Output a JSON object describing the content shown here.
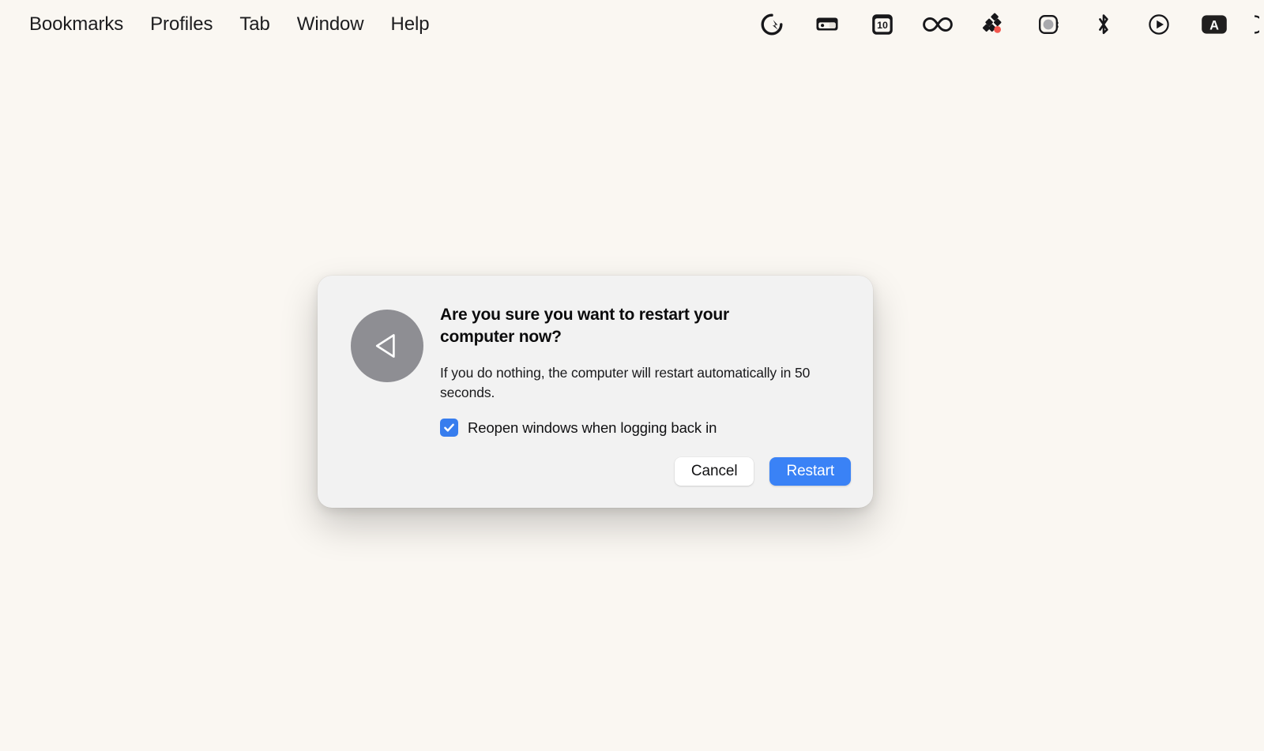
{
  "menubar": {
    "items": [
      {
        "label": "Bookmarks",
        "name": "menu-bookmarks"
      },
      {
        "label": "Profiles",
        "name": "menu-profiles"
      },
      {
        "label": "Tab",
        "name": "menu-tab"
      },
      {
        "label": "Window",
        "name": "menu-window"
      },
      {
        "label": "Help",
        "name": "menu-help"
      }
    ],
    "status_icons": [
      {
        "icon": "quicksilver-q-icon",
        "label": ""
      },
      {
        "icon": "wallet-card-icon",
        "label": ""
      },
      {
        "icon": "calendar-icon",
        "label": "10"
      },
      {
        "icon": "infinity-icon",
        "label": ""
      },
      {
        "icon": "diamond-grid-red-dot-icon",
        "label": ""
      },
      {
        "icon": "watch-camera-icon",
        "label": ""
      },
      {
        "icon": "bluetooth-icon",
        "label": ""
      },
      {
        "icon": "play-circle-icon",
        "label": ""
      },
      {
        "icon": "text-input-a-badge-icon",
        "label": "A"
      },
      {
        "icon": "clock-edge-icon",
        "label": ""
      }
    ]
  },
  "dialog": {
    "icon": "restart-back-triangle-icon",
    "title": "Are you sure you want to restart your computer now?",
    "message": "If you do nothing, the computer will restart automatically in 50 seconds.",
    "checkbox": {
      "label": "Reopen windows when logging back in",
      "checked": true
    },
    "buttons": {
      "cancel": "Cancel",
      "restart": "Restart"
    }
  },
  "colors": {
    "desktop_background": "#faf7f2",
    "dialog_background": "#f2f2f2",
    "accent_blue": "#3a82f6",
    "checkbox_blue": "#377dee",
    "icon_gray": "#8e8e93",
    "text_primary": "#0b0b0c",
    "badge_red": "#f2584f"
  }
}
